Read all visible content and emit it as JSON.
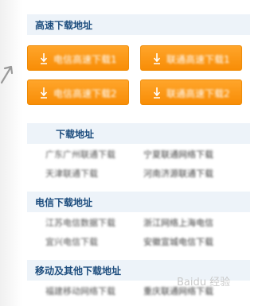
{
  "highspeed": {
    "title": "高速下载地址",
    "buttons": [
      "电信高速下载1",
      "联通高速下载1",
      "电信高速下载2",
      "联通高速下载2"
    ]
  },
  "section2": {
    "title": "下载地址",
    "links": [
      "广东广州联通下载",
      "宁夏联通网络下载",
      "天津联通下载",
      "河南济源联通下载"
    ]
  },
  "section3": {
    "title": "电信下载地址",
    "links": [
      "江苏电信数据下载",
      "浙江网络上海电信",
      "宜兴电信下载",
      "安徽宣城电信下载"
    ]
  },
  "section4": {
    "title": "移动及其他下载地址",
    "links": [
      "福建移动网络下载",
      "重庆联通网络下载"
    ]
  },
  "watermark": "Baidu 经验"
}
